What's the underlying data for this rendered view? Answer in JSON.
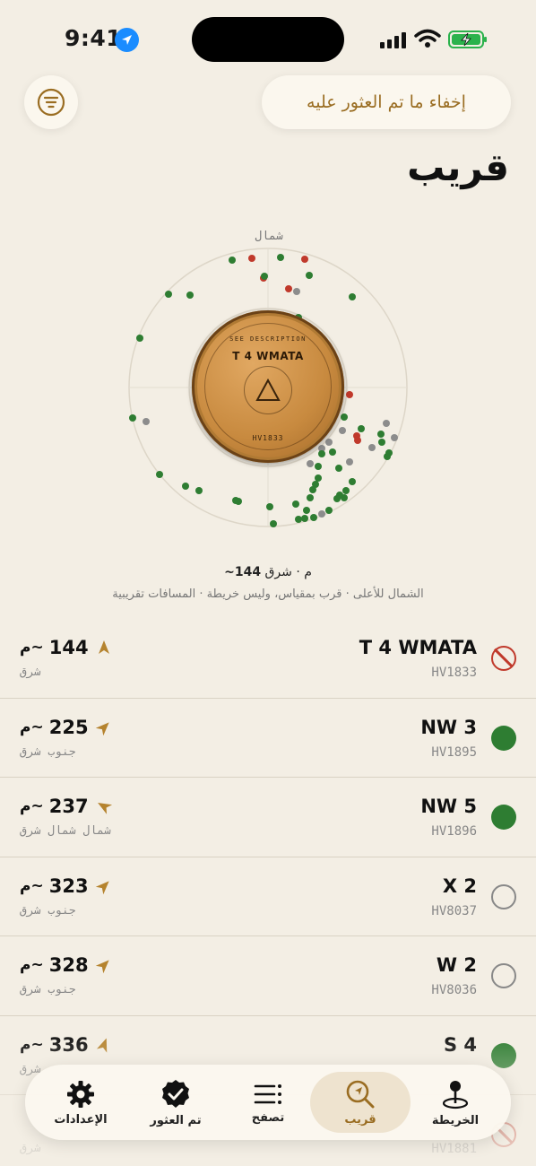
{
  "status": {
    "time": "9:41"
  },
  "header": {
    "hide_found_label": "إخفاء ما تم العثور عليه",
    "title": "قريب"
  },
  "radar": {
    "north_label": "شمال",
    "center": {
      "title": "T 4 WMATA",
      "arc_text": "SEE DESCRIPTION",
      "code": "HV1833"
    },
    "readout_distance": "~144",
    "readout_unit": "م",
    "readout_direction": "شرق",
    "note": "الشمال للأعلى · قرب بمقياس، وليس خريطة · المسافات تقريبية",
    "colors": {
      "found": "#2E7D32",
      "unfound": "#8C8C8C",
      "blocked": "#C0392B",
      "accent": "#9A6D22"
    }
  },
  "list": [
    {
      "name": "T 4 WMATA",
      "code": "HV1833",
      "distance": "144",
      "unit": "م~",
      "direction": "شرق",
      "status": "blocked",
      "heading_deg": 90
    },
    {
      "name": "NW 3",
      "code": "HV1895",
      "distance": "225",
      "unit": "م~",
      "direction": "جنوب شرق",
      "status": "found",
      "heading_deg": 135
    },
    {
      "name": "NW 5",
      "code": "HV1896",
      "distance": "237",
      "unit": "م~",
      "direction": "شمال شمال شرق",
      "status": "found",
      "heading_deg": 30
    },
    {
      "name": "X 2",
      "code": "HV8037",
      "distance": "323",
      "unit": "م~",
      "direction": "جنوب شرق",
      "status": "open",
      "heading_deg": 135
    },
    {
      "name": "W 2",
      "code": "HV8036",
      "distance": "328",
      "unit": "م~",
      "direction": "جنوب شرق",
      "status": "open",
      "heading_deg": 135
    },
    {
      "name": "S 4",
      "code": "",
      "distance": "336",
      "unit": "م~",
      "direction": "شرق",
      "status": "found",
      "heading_deg": 110
    },
    {
      "name": "",
      "code": "HV1881",
      "distance": "",
      "unit": "",
      "direction": "شرق",
      "status": "blocked",
      "heading_deg": 90
    }
  ],
  "tabbar": {
    "settings": "الإعدادات",
    "found": "تم العثور",
    "browse": "تصفح",
    "nearby": "قريب",
    "map": "الخريطة"
  },
  "icons": {
    "filter": "filter-icon",
    "settings": "gear-icon",
    "found": "verified-badge-icon",
    "browse": "list-icon",
    "nearby": "compass-search-icon",
    "map": "map-pin-icon"
  }
}
